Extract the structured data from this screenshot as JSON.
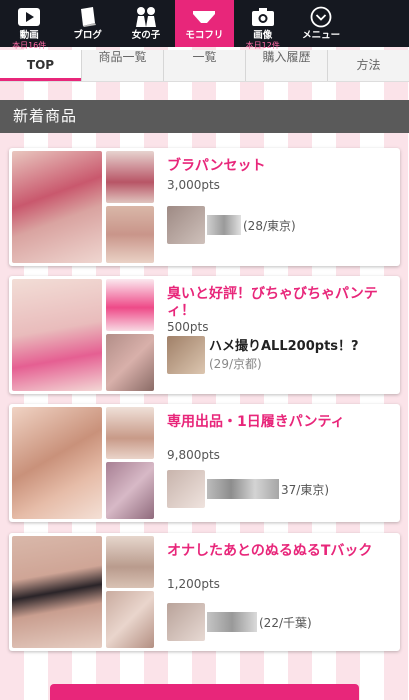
{
  "nav": {
    "items": [
      {
        "label": "動画",
        "icon": "play-icon",
        "badge": "本日16件"
      },
      {
        "label": "ブログ",
        "icon": "book-icon",
        "badge": ""
      },
      {
        "label": "女の子",
        "icon": "girls-icon",
        "badge": ""
      },
      {
        "label": "モコフリ",
        "icon": "panties-icon",
        "badge": ""
      },
      {
        "label": "画像",
        "icon": "camera-icon",
        "badge": "本日12件"
      },
      {
        "label": "メニュー",
        "icon": "chevron-down-icon",
        "badge": ""
      }
    ],
    "active_color": "#e8267a"
  },
  "subtabs": [
    "TOP",
    "商品一覧",
    "一覧",
    "購入履歴",
    "方法"
  ],
  "section": {
    "title": "新着商品"
  },
  "products": [
    {
      "title": "ブラパンセット",
      "price": "3,000pts",
      "seller_name": "",
      "seller_info": "(28/東京)"
    },
    {
      "title": "臭いと好評！びちゃびちゃパンティ！",
      "price": "500pts",
      "seller_name": "ハメ撮りALL200pts！?",
      "seller_info": "(29/京都)"
    },
    {
      "title": "専用出品・1日履きパンティ",
      "price": "9,800pts",
      "seller_name": "",
      "seller_info": "37/東京)"
    },
    {
      "title": "オナしたあとのぬるぬるTバック",
      "price": "1,200pts",
      "seller_name": "",
      "seller_info": "(22/千葉)"
    }
  ]
}
